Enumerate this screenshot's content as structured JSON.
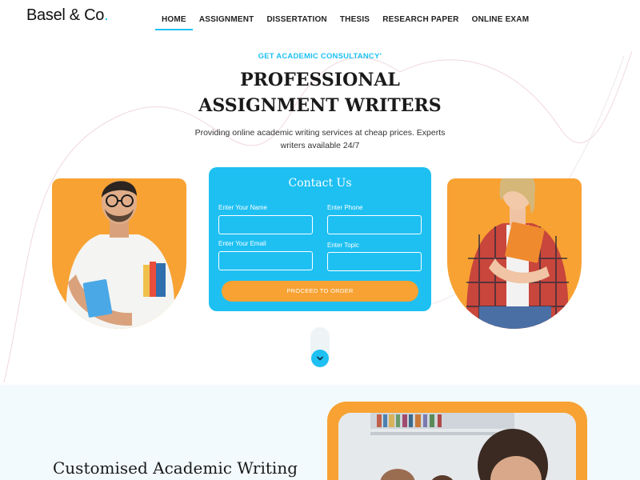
{
  "brand": {
    "name": "Basel & Co",
    "dot": ".",
    "accent": "#1ec0f2",
    "orange": "#f7a233"
  },
  "nav": {
    "items": [
      {
        "label": "HOME",
        "active": true
      },
      {
        "label": "ASSIGNMENT",
        "active": false
      },
      {
        "label": "DISSERTATION",
        "active": false
      },
      {
        "label": "THESIS",
        "active": false
      },
      {
        "label": "RESEARCH PAPER",
        "active": false
      },
      {
        "label": "ONLINE EXAM",
        "active": false
      }
    ]
  },
  "hero": {
    "eyebrow": "GET ACADEMIC CONSULTANCY’",
    "headline_line1": "PROFESSIONAL",
    "headline_line2": "ASSIGNMENT WRITERS",
    "subtext": "Providing online academic writing services at cheap prices. Experts writers available 24/7"
  },
  "contact": {
    "title": "Contact Us",
    "name_label": "Enter Your Name",
    "phone_label": "Enter Phone",
    "email_label": "Enter Your Email",
    "topic_label": "Enter Topic",
    "name_value": "",
    "phone_value": "",
    "email_value": "",
    "topic_value": "",
    "submit_label": "PROCEED TO ORDER"
  },
  "scroll": {
    "icon": "chevron-down-icon"
  },
  "section2": {
    "title": "Customised Academic Writing"
  }
}
